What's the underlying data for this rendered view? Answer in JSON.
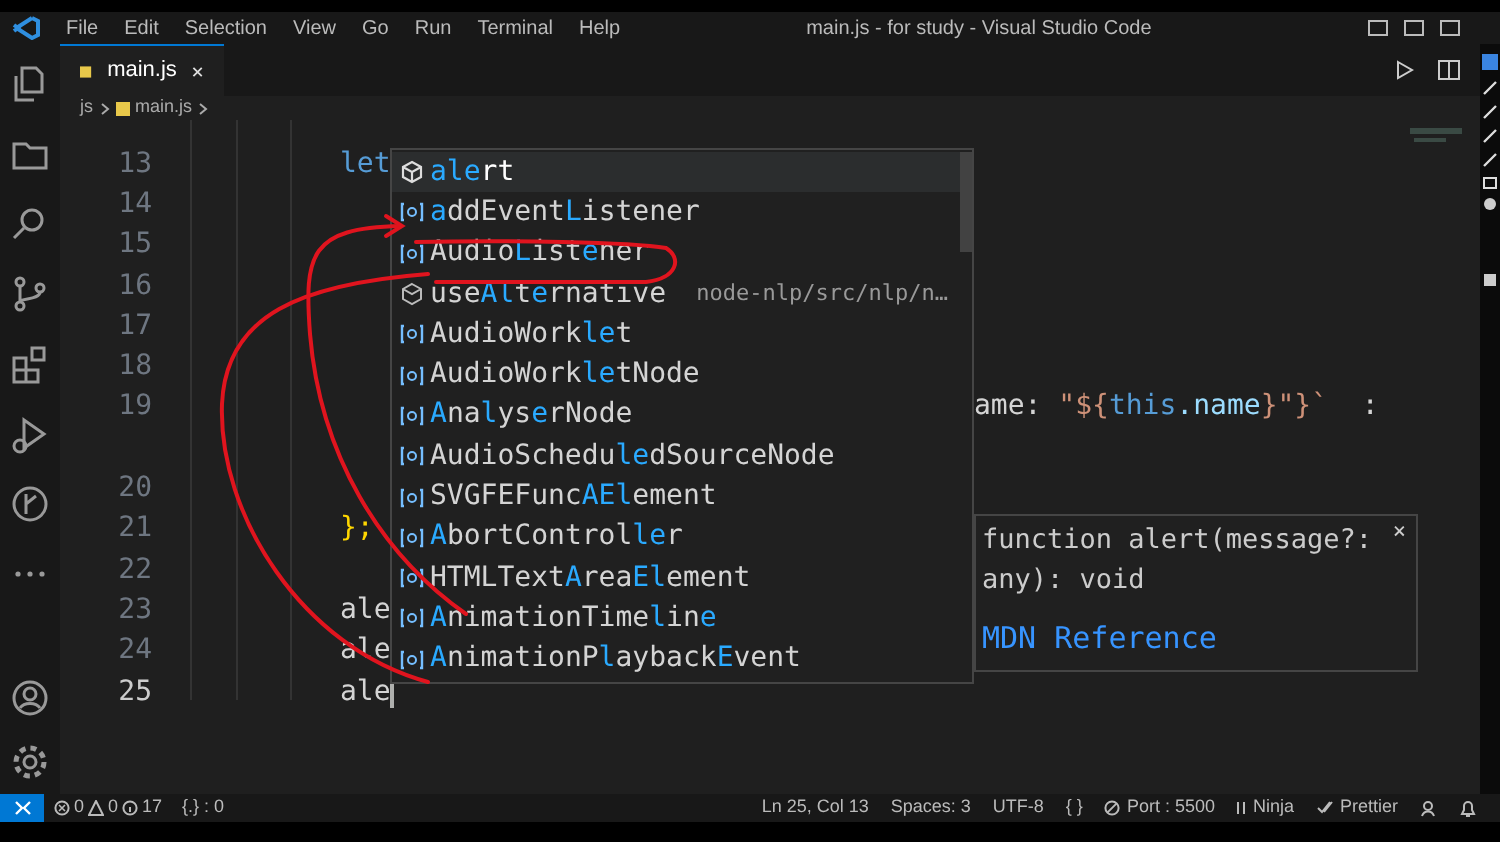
{
  "menu": [
    "File",
    "Edit",
    "Selection",
    "View",
    "Go",
    "Run",
    "Terminal",
    "Help"
  ],
  "window": {
    "title": "main.js - for study - Visual Studio Code"
  },
  "tabs": [
    {
      "label": "main.js",
      "selected": true
    }
  ],
  "breadcrumb": [
    "js",
    "main.js"
  ],
  "activity_bar": [
    {
      "kind": "files"
    },
    {
      "kind": "explorer"
    },
    {
      "kind": "search"
    },
    {
      "kind": "source-control"
    },
    {
      "kind": "extensions"
    },
    {
      "kind": "run"
    },
    {
      "kind": "git"
    },
    {
      "kind": "more"
    }
  ],
  "editor": {
    "lines": [
      {
        "number": "13",
        "tokens": [
          {
            "kind": "keyword",
            "text": "let"
          }
        ]
      },
      {
        "number": "14"
      },
      {
        "number": "15"
      },
      {
        "number": "16"
      },
      {
        "number": "17"
      },
      {
        "number": "18"
      },
      {
        "number": "19",
        "covered": true,
        "wrapped": true,
        "tokens": [
          {
            "kind": "plain",
            "text": "ame: "
          },
          {
            "kind": "string",
            "text": "\"${"
          },
          {
            "kind": "keyword",
            "text": "this"
          },
          {
            "kind": "property",
            "text": ".name"
          },
          {
            "kind": "string",
            "text": "}\"}`"
          },
          {
            "kind": "plain",
            "text": "  :"
          }
        ]
      },
      {
        "number": "20"
      },
      {
        "number": "21",
        "tokens": [
          {
            "kind": "brace",
            "text": "};"
          }
        ]
      },
      {
        "number": "22"
      },
      {
        "number": "23",
        "tokens": [
          {
            "kind": "plain",
            "text": "ale"
          }
        ]
      },
      {
        "number": "24",
        "tokens": [
          {
            "kind": "plain",
            "text": "ale"
          }
        ]
      },
      {
        "number": "25",
        "current": true,
        "tokens": [
          {
            "kind": "plain",
            "text": "ale"
          }
        ]
      }
    ]
  },
  "suggestions": [
    {
      "kind": "method",
      "selected": true,
      "parts": [
        {
          "text": "ale",
          "match": true
        },
        {
          "text": "rt",
          "match": false
        }
      ]
    },
    {
      "kind": "variable",
      "selected": false,
      "parts": [
        {
          "text": "a",
          "match": true
        },
        {
          "text": "ddEvent",
          "match": false
        },
        {
          "text": "L",
          "match": true
        },
        {
          "text": "istener",
          "match": false
        }
      ]
    },
    {
      "kind": "variable",
      "selected": false,
      "parts": [
        {
          "text": "Audio",
          "match": false
        },
        {
          "text": "L",
          "match": true
        },
        {
          "text": "ist",
          "match": false
        },
        {
          "text": "e",
          "match": true
        },
        {
          "text": "ner",
          "match": false
        }
      ]
    },
    {
      "kind": "module",
      "selected": false,
      "parts": [
        {
          "text": "use",
          "match": false
        },
        {
          "text": "Al",
          "match": true
        },
        {
          "text": "t",
          "match": false
        },
        {
          "text": "e",
          "match": true
        },
        {
          "text": "rnative",
          "match": false
        }
      ],
      "detail": "node-nlp/src/nlp/n…"
    },
    {
      "kind": "variable",
      "selected": false,
      "parts": [
        {
          "text": "AudioWork",
          "match": false
        },
        {
          "text": "le",
          "match": true
        },
        {
          "text": "t",
          "match": false
        }
      ]
    },
    {
      "kind": "variable",
      "selected": false,
      "parts": [
        {
          "text": "AudioWork",
          "match": false
        },
        {
          "text": "le",
          "match": true
        },
        {
          "text": "tNode",
          "match": false
        }
      ]
    },
    {
      "kind": "variable",
      "selected": false,
      "parts": [
        {
          "text": "A",
          "match": true
        },
        {
          "text": "na",
          "match": false
        },
        {
          "text": "l",
          "match": true
        },
        {
          "text": "ys",
          "match": false
        },
        {
          "text": "e",
          "match": true
        },
        {
          "text": "rNode",
          "match": false
        }
      ]
    },
    {
      "kind": "variable",
      "selected": false,
      "parts": [
        {
          "text": "AudioSchedu",
          "match": false
        },
        {
          "text": "le",
          "match": true
        },
        {
          "text": "dSourceNode",
          "match": false
        }
      ]
    },
    {
      "kind": "variable",
      "selected": false,
      "parts": [
        {
          "text": "SVGFEFunc",
          "match": false
        },
        {
          "text": "AEl",
          "match": true
        },
        {
          "text": "ement",
          "match": false
        }
      ]
    },
    {
      "kind": "variable",
      "selected": false,
      "parts": [
        {
          "text": "A",
          "match": true
        },
        {
          "text": "bortControl",
          "match": false
        },
        {
          "text": "le",
          "match": true
        },
        {
          "text": "r",
          "match": false
        }
      ]
    },
    {
      "kind": "variable",
      "selected": false,
      "parts": [
        {
          "text": "HTMLText",
          "match": false
        },
        {
          "text": "A",
          "match": true
        },
        {
          "text": "rea",
          "match": false
        },
        {
          "text": "El",
          "match": true
        },
        {
          "text": "ement",
          "match": false
        }
      ]
    },
    {
      "kind": "variable",
      "selected": false,
      "parts": [
        {
          "text": "A",
          "match": true
        },
        {
          "text": "nimationTime",
          "match": false
        },
        {
          "text": "l",
          "match": true
        },
        {
          "text": "in",
          "match": false
        },
        {
          "text": "e",
          "match": true
        }
      ]
    },
    {
      "kind": "variable",
      "selected": false,
      "parts": [
        {
          "text": "A",
          "match": true
        },
        {
          "text": "nimationP",
          "match": false
        },
        {
          "text": "l",
          "match": true
        },
        {
          "text": "ayback",
          "match": false
        },
        {
          "text": "E",
          "match": true
        },
        {
          "text": "vent",
          "match": false
        }
      ]
    }
  ],
  "hover": {
    "signature": "function alert(message?: any): void",
    "link": "MDN Reference",
    "close": "×"
  },
  "status_bar": {
    "errors": "0",
    "warnings": "0",
    "infos": "17",
    "selection": "{.} : 0",
    "right": [
      {
        "kind": "text",
        "text": "Ln 25, Col 13"
      },
      {
        "kind": "text",
        "text": "Spaces: 3"
      },
      {
        "kind": "text",
        "text": "UTF-8"
      },
      {
        "kind": "text",
        "text": "{ }"
      },
      {
        "kind": "port",
        "text": "Port : 5500"
      },
      {
        "kind": "ninja",
        "text": "Ninja"
      },
      {
        "kind": "check",
        "text": "Prettier"
      },
      {
        "kind": "feedback"
      },
      {
        "kind": "bell"
      }
    ]
  }
}
